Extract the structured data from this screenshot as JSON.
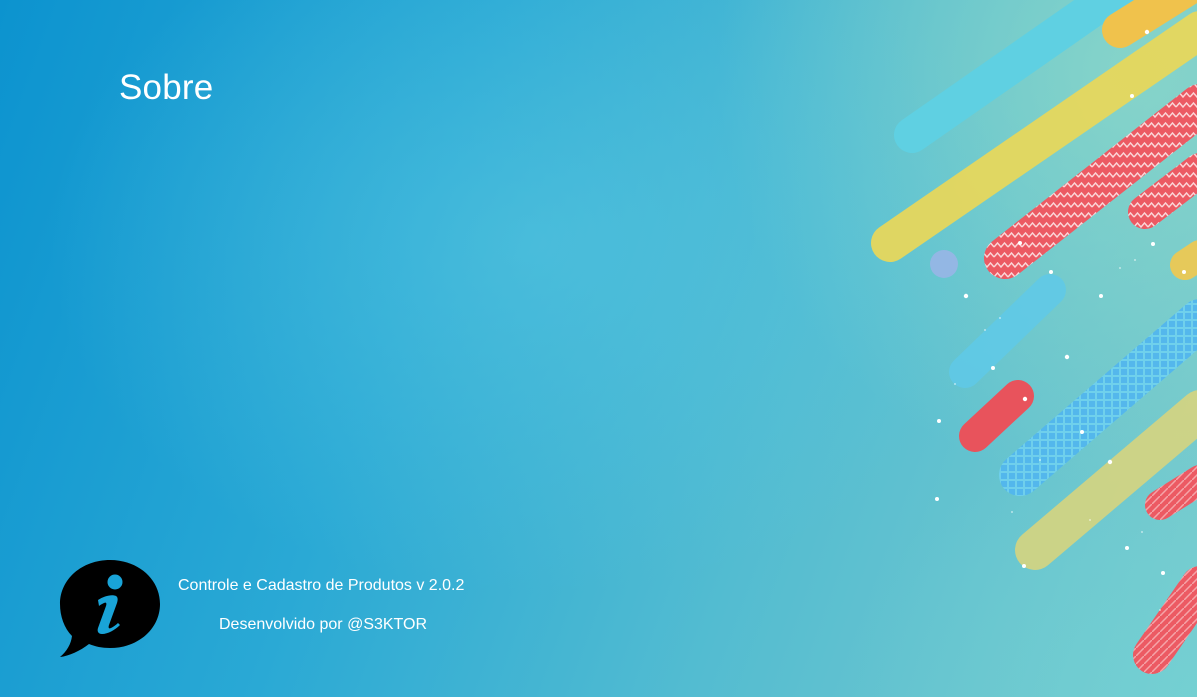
{
  "window": {
    "title": "Sobre"
  },
  "about": {
    "app_line": "Controle e Cadastro de Produtos v 2.0.2",
    "developer_line": "Desenvolvido por @S3KTOR"
  },
  "icons": {
    "info": "info-speech-bubble-icon"
  },
  "colors": {
    "text": "#ffffff",
    "stripe_yellow": "#e8d65a",
    "stripe_red": "#ec5a63",
    "stripe_blue": "#5cc9e6"
  }
}
